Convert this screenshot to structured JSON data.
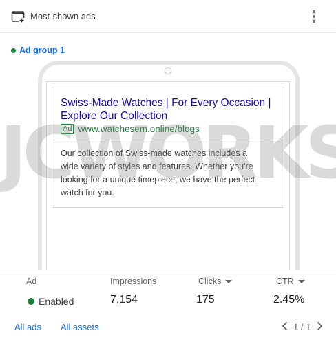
{
  "header": {
    "title": "Most-shown ads",
    "icon": "browser-window-icon",
    "menu_icon": "more-vert-icon"
  },
  "ad_group": {
    "label": "Ad group 1",
    "status_color": "#188038"
  },
  "ad_preview": {
    "headline": "Swiss-Made Watches | For Every Occasion | Explore Our Collection",
    "badge": "Ad",
    "display_url": "www.watchesem.online/blogs",
    "description": "Our collection of Swiss-made watches includes a wide variety of styles and features. Whether you're looking for a unique timepiece, we have the perfect watch for you."
  },
  "watermark": "JCWORKS",
  "stats": {
    "ad_label": "Ad",
    "impressions_label": "Impressions",
    "clicks_label": "Clicks",
    "ctr_label": "CTR",
    "status": "Enabled",
    "impressions": "7,154",
    "clicks": "175",
    "ctr": "2.45%"
  },
  "footer": {
    "all_ads": "All ads",
    "all_assets": "All assets",
    "pagination": "1 / 1"
  },
  "colors": {
    "link": "#1a73e8",
    "headline": "#1a0dab",
    "green": "#188038"
  }
}
